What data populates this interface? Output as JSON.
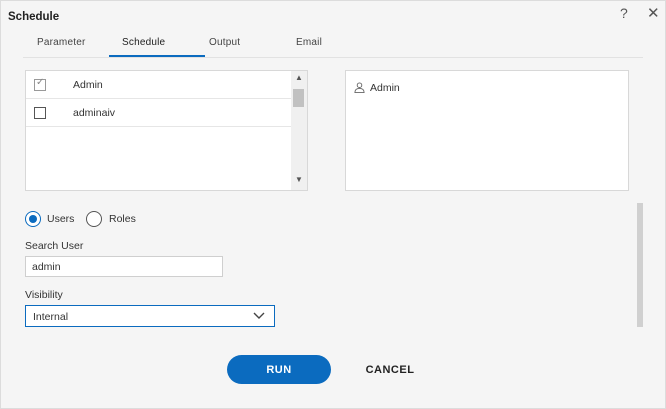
{
  "dialog": {
    "title": "Schedule",
    "help": "?",
    "close": "✕"
  },
  "tabs": [
    {
      "label": "Parameter"
    },
    {
      "label": "Schedule"
    },
    {
      "label": "Output"
    },
    {
      "label": "Email"
    }
  ],
  "active_tab": "Schedule",
  "user_list": {
    "items": [
      {
        "label": "Admin",
        "checked": true
      },
      {
        "label": "adminaiv",
        "checked": false
      }
    ]
  },
  "selected_users": {
    "items": [
      {
        "label": "Admin",
        "icon": "user-icon"
      }
    ]
  },
  "mode": {
    "options": [
      {
        "label": "Users",
        "selected": true
      },
      {
        "label": "Roles",
        "selected": false
      }
    ]
  },
  "search": {
    "label": "Search User",
    "value": "admin"
  },
  "visibility": {
    "label": "Visibility",
    "value": "Internal"
  },
  "actions": {
    "run": "RUN",
    "cancel": "CANCEL"
  },
  "colors": {
    "accent": "#0b6bbf",
    "background": "#f5f5f5"
  }
}
